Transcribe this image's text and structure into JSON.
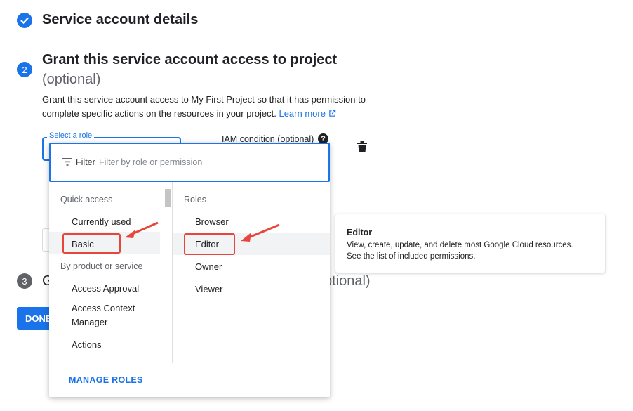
{
  "steps": [
    {
      "number": "",
      "title": "Service account details"
    },
    {
      "number": "2",
      "title": "Grant this service account access to project",
      "optional": "(optional)"
    },
    {
      "number": "3",
      "title_start": "G",
      "title_end": "ptional)"
    }
  ],
  "step2": {
    "description_line1": "Grant this service account access to My First Project so that it has permission to",
    "description_line2": "complete specific actions on the resources in your project.",
    "learn_more": "Learn more"
  },
  "role_field": {
    "label": "Select a role"
  },
  "iam_condition": {
    "label": "IAM condition (optional)"
  },
  "dropdown": {
    "filter_label": "Filter",
    "filter_placeholder": "Filter by role or permission",
    "left_sections": {
      "quick_access": "Quick access",
      "currently_used": "Currently used",
      "basic": "Basic",
      "by_product": "By product or service",
      "access_approval": "Access Approval",
      "access_context_manager_l1": "Access Context",
      "access_context_manager_l2": "Manager",
      "actions": "Actions"
    },
    "roles_header": "Roles",
    "roles": [
      "Browser",
      "Editor",
      "Owner",
      "Viewer"
    ],
    "manage_roles": "MANAGE ROLES"
  },
  "tooltip": {
    "title": "Editor",
    "line1": "View, create, update, and delete most Google Cloud resources.",
    "line2": "See the list of included permissions."
  },
  "done_button": "DONE",
  "colors": {
    "accent": "#1a73e8",
    "annotation": "#e8453c",
    "step3": "#5f6368"
  }
}
